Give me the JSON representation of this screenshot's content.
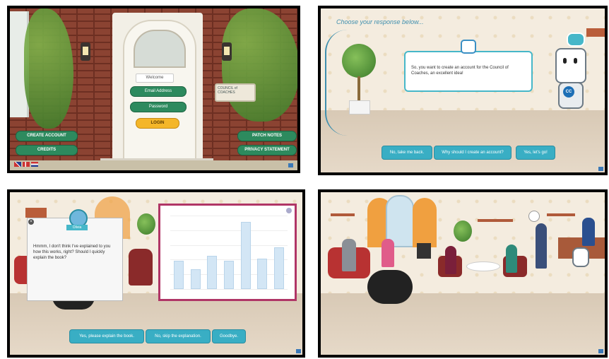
{
  "panel1": {
    "welcome_label": "Welcome",
    "email_placeholder": "Email Address",
    "password_placeholder": "Password",
    "login_label": "LOGIN",
    "create_account_label": "CREATE ACCOUNT",
    "credits_label": "CREDITS",
    "patch_notes_label": "PATCH NOTES",
    "privacy_label": "PRIVACY STATEMENT",
    "logo_text": "COUNCIL of COACHES",
    "languages": [
      "english-flag",
      "danish-flag",
      "dutch-flag"
    ]
  },
  "panel2": {
    "heading": "Choose your response below...",
    "robot_speech": "So, you want to create an account for the Council of Coaches, an excellent idea!",
    "buttons": [
      "No, take me back.",
      "Why should I create an account?",
      "Yes, let's go!"
    ],
    "robot_badge": "CC"
  },
  "panel3": {
    "coach_name": "Olivia",
    "coach_speech": "Hmmm, I don't think I've explained to you how this works, right? Should I quickly explain the book?",
    "buttons": [
      "Yes, please explain the book.",
      "No, skip the explanation.",
      "Goodbye."
    ],
    "chart_data": {
      "type": "bar",
      "title": "",
      "xlabel": "",
      "ylabel": "",
      "categories": [
        "",
        "",
        "",
        "",
        "",
        "",
        "",
        ""
      ],
      "values": [
        42,
        30,
        50,
        42,
        100,
        46,
        62
      ],
      "ylim": [
        0,
        110
      ]
    }
  },
  "panel4": {},
  "colors": {
    "accent_teal": "#39aec4",
    "button_green": "#2d8a5e",
    "login_yellow": "#f4b629",
    "book_border": "#b03566"
  }
}
